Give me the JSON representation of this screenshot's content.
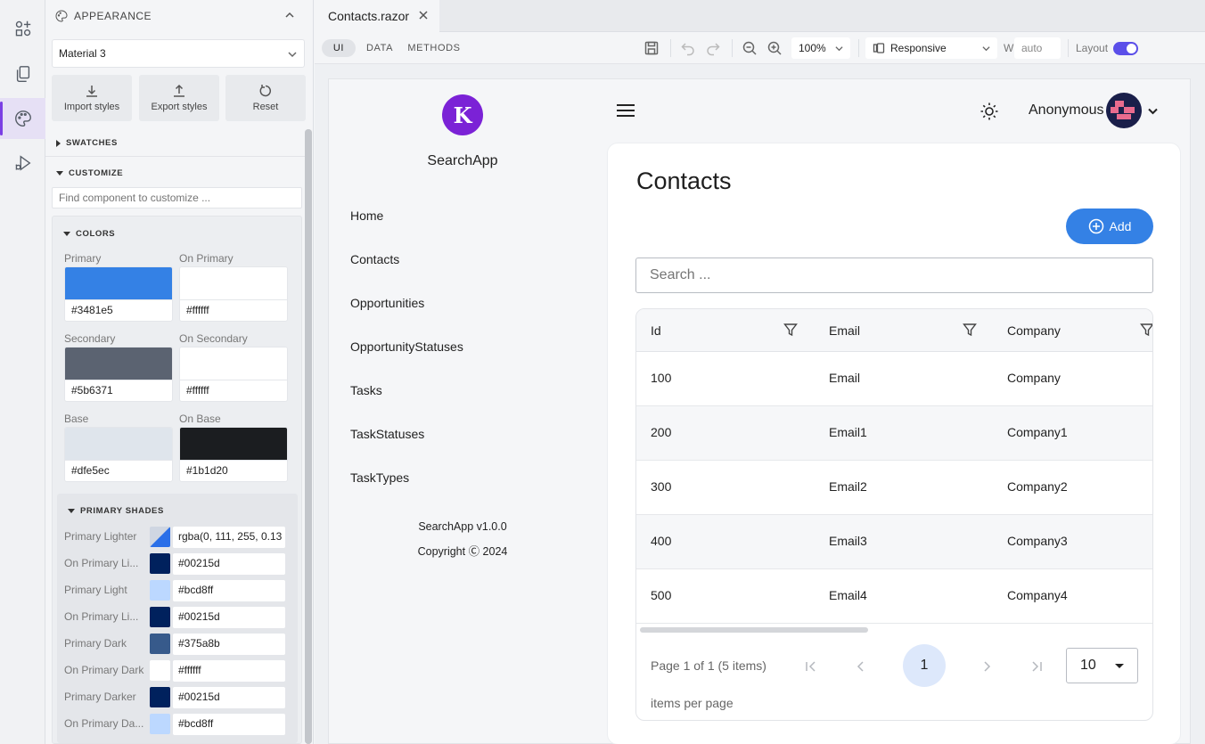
{
  "rail": {
    "items": [
      "add-component",
      "pages",
      "appearance",
      "run-debug"
    ]
  },
  "appearance": {
    "header": "APPEARANCE",
    "theme": "Material 3",
    "buttons": {
      "import": "Import styles",
      "export": "Export styles",
      "reset": "Reset"
    },
    "sections": {
      "swatches": "SWATCHES",
      "customize": "CUSTOMIZE",
      "colors": "COLORS",
      "primary_shades": "PRIMARY SHADES"
    },
    "find_placeholder": "Find component to customize ...",
    "colors": [
      {
        "label": "Primary",
        "hex": "#3481e5",
        "color": "#3481e5"
      },
      {
        "label": "On Primary",
        "hex": "#ffffff",
        "color": "#ffffff"
      },
      {
        "label": "Secondary",
        "hex": "#5b6371",
        "color": "#5b6371"
      },
      {
        "label": "On Secondary",
        "hex": "#ffffff",
        "color": "#ffffff"
      },
      {
        "label": "Base",
        "hex": "#dfe5ec",
        "color": "#dfe5ec"
      },
      {
        "label": "On Base",
        "hex": "#1b1d20",
        "color": "#1b1d20"
      }
    ],
    "shades": [
      {
        "label": "Primary Lighter",
        "value": "rgba(0, 111, 255, 0.13",
        "color": "#2a6fe8"
      },
      {
        "label": "On Primary Li...",
        "value": "#00215d",
        "color": "#00215d"
      },
      {
        "label": "Primary Light",
        "value": "#bcd8ff",
        "color": "#bcd8ff"
      },
      {
        "label": "On Primary Li...",
        "value": "#00215d",
        "color": "#00215d"
      },
      {
        "label": "Primary Dark",
        "value": "#375a8b",
        "color": "#375a8b"
      },
      {
        "label": "On Primary Dark",
        "value": "#ffffff",
        "color": "#ffffff"
      },
      {
        "label": "Primary Darker",
        "value": "#00215d",
        "color": "#00215d"
      },
      {
        "label": "On Primary Da...",
        "value": "#bcd8ff",
        "color": "#bcd8ff"
      }
    ]
  },
  "editor": {
    "file_tab": "Contacts.razor",
    "view_tabs": [
      "UI",
      "DATA",
      "METHODS"
    ],
    "zoom": "100%",
    "device": "Responsive",
    "width_label": "W",
    "width_value": "auto",
    "layout_label": "Layout",
    "layout_on": true
  },
  "app": {
    "name": "SearchApp",
    "logo_letter": "K",
    "nav": [
      "Home",
      "Contacts",
      "Opportunities",
      "OpportunityStatuses",
      "Tasks",
      "TaskStatuses",
      "TaskTypes"
    ],
    "version": "SearchApp v1.0.0",
    "copyright": "Copyright Ⓒ 2024",
    "user": "Anonymous",
    "page_title": "Contacts",
    "add_label": "Add",
    "search_placeholder": "Search ...",
    "columns": [
      "Id",
      "Email",
      "Company"
    ],
    "rows": [
      [
        "100",
        "Email",
        "Company"
      ],
      [
        "200",
        "Email1",
        "Company1"
      ],
      [
        "300",
        "Email2",
        "Company2"
      ],
      [
        "400",
        "Email3",
        "Company3"
      ],
      [
        "500",
        "Email4",
        "Company4"
      ]
    ],
    "pager_summary": "Page 1 of 1 (5 items)",
    "current_page": "1",
    "page_size": "10",
    "items_per_page": "items per page"
  }
}
